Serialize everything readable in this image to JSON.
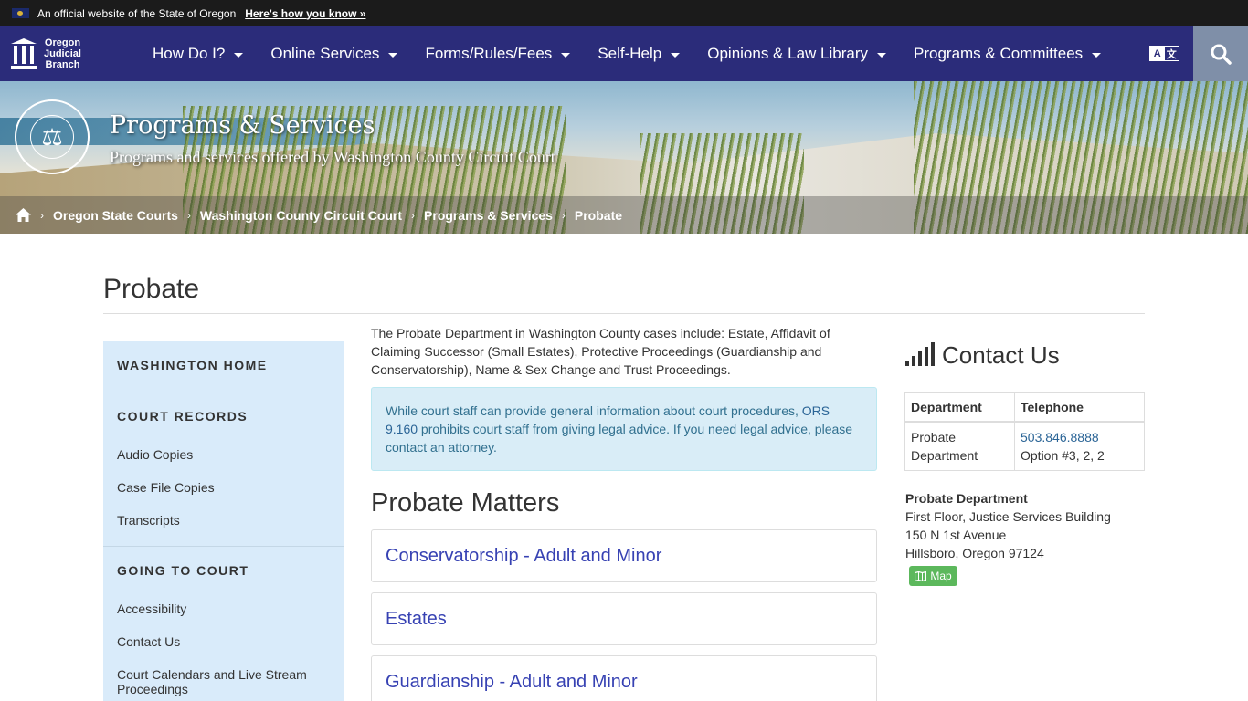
{
  "gov_banner": {
    "official_text": "An official website of the State of Oregon",
    "how_link": "Here's how you know »"
  },
  "nav": {
    "logo_text": [
      "Oregon",
      "Judicial",
      "Branch"
    ],
    "items": [
      {
        "label": "How Do I?"
      },
      {
        "label": "Online Services"
      },
      {
        "label": "Forms/Rules/Fees"
      },
      {
        "label": "Self-Help"
      },
      {
        "label": "Opinions & Law Library"
      },
      {
        "label": "Programs & Committees"
      }
    ],
    "translate_icon": "translate-icon",
    "search_icon": "search-icon"
  },
  "hero": {
    "title": "Programs & Services",
    "subtitle": "Programs and services offered by Washington County Circuit Court",
    "breadcrumbs": [
      "Oregon State Courts",
      "Washington County Circuit Court",
      "Programs & Services",
      "Probate"
    ]
  },
  "page": {
    "title": "Probate"
  },
  "sidebar": {
    "sections": [
      {
        "heading": "WASHINGTON HOME",
        "links": []
      },
      {
        "heading": "COURT RECORDS",
        "links": [
          "Audio Copies",
          "Case File Copies",
          "Transcripts"
        ]
      },
      {
        "heading": "GOING TO COURT",
        "links": [
          "Accessibility",
          "Contact Us",
          "Court Calendars and Live Stream Proceedings"
        ]
      }
    ]
  },
  "main": {
    "intro": "The Probate Department in Washington County cases include: Estate, Affidavit of Claiming Successor (Small Estates), Protective Proceedings (Guardianship and Conservatorship), Name & Sex Change and Trust Proceedings.",
    "alert_before": "While court staff can provide general information about court procedures, ",
    "alert_link": "ORS 9.160",
    "alert_after": " prohibits court staff from giving legal advice. If you need legal advice, please contact an attorney.",
    "matters_title": "Probate Matters",
    "matters": [
      "Conservatorship - Adult and Minor",
      "Estates",
      "Guardianship - Adult and Minor"
    ]
  },
  "contact": {
    "title": "Contact Us",
    "table_headers": [
      "Department",
      "Telephone"
    ],
    "dept": "Probate Department",
    "phone": "503.846.8888",
    "phone_option": "Option #3, 2, 2",
    "address_name": "Probate Department",
    "address_lines": [
      "First Floor, Justice Services Building",
      "150 N 1st Avenue",
      "Hillsboro, Oregon 97124"
    ],
    "map_label": "Map"
  },
  "colors": {
    "nav_bg": "#2b2c7a",
    "sidebar_bg": "#d9ebfa",
    "alert_bg": "#d9edf7",
    "link": "#3742b3",
    "map_btn": "#5cb85c"
  }
}
